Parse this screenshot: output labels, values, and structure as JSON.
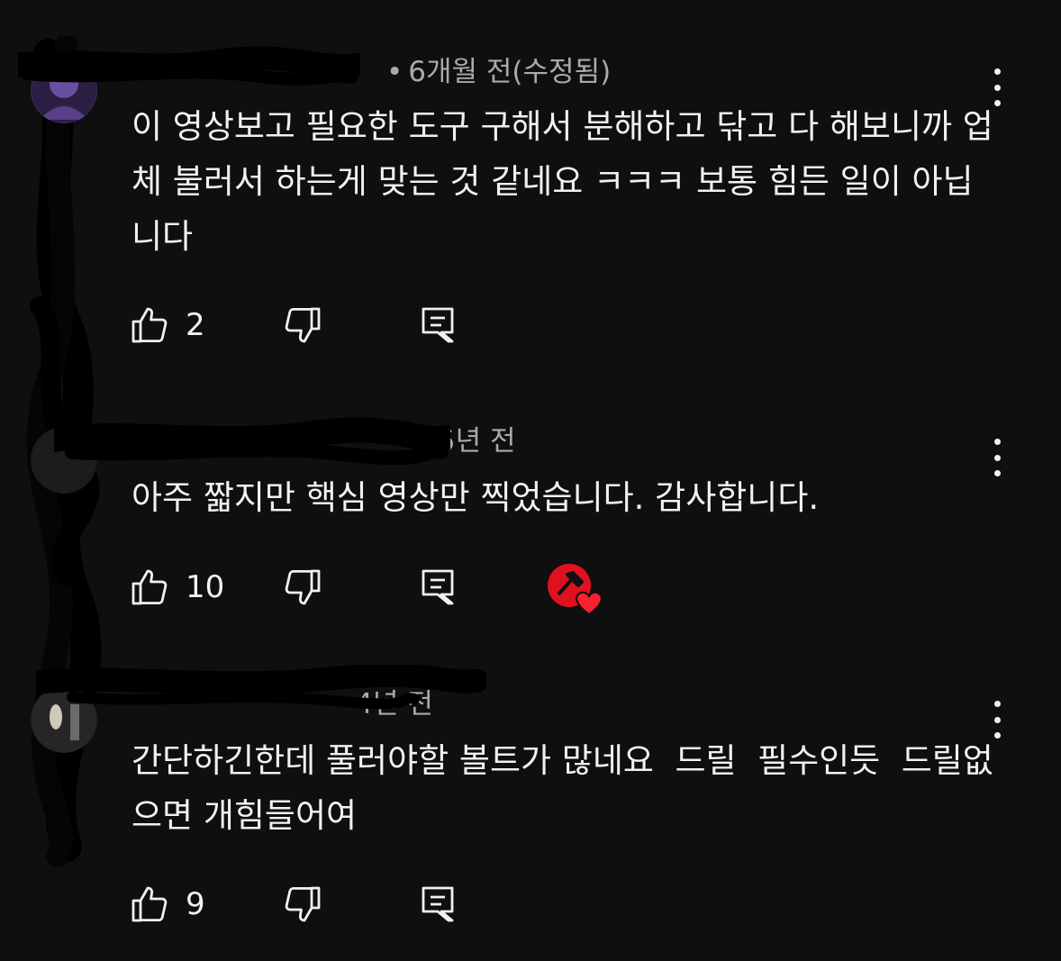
{
  "comments": [
    {
      "time": "6개월 전(수정됨)",
      "text": "이 영상보고 필요한 도구 구해서 분해하고 닦고 다 해보니까 업체 불러서 하는게 맞는 것 같네요 ㅋㅋㅋ 보통 힘든 일이 아닙니다",
      "likes": "2",
      "creator_heart": false
    },
    {
      "time": "5년 전",
      "text": "아주 짧지만 핵심 영상만 찍었습니다. 감사합니다.",
      "likes": "10",
      "creator_heart": true
    },
    {
      "time": "4년 전",
      "text": "간단하긴한데 풀러야할 볼트가 많네요  드릴  필수인듯  드릴없으면 개힘들어여",
      "likes": "9",
      "creator_heart": false
    }
  ],
  "icons": {
    "like": "thumb-up-icon",
    "dislike": "thumb-down-icon",
    "reply": "reply-icon",
    "menu": "more-vert-icon",
    "heart": "creator-heart-icon"
  },
  "colors": {
    "background": "#0f0f0f",
    "text": "#f1f1f1",
    "meta": "#aaaaaa",
    "heart": "#ff1f2d"
  }
}
